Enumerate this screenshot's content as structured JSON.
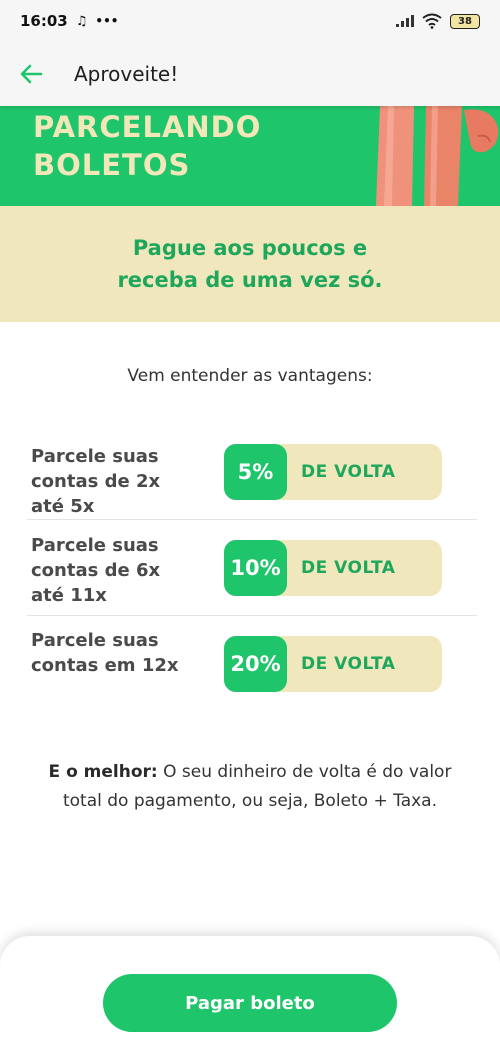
{
  "status_bar": {
    "time": "16:03",
    "more": "•••",
    "battery": "38"
  },
  "app_bar": {
    "title": "Aproveite!"
  },
  "banner": {
    "line1": "PARCELANDO",
    "line2": "BOLETOS"
  },
  "tagline": {
    "line1": "Pague aos poucos e",
    "line2": "receba de uma vez só."
  },
  "intro": "Vem entender as vantagens:",
  "benefits": [
    {
      "line1": "Parcele suas",
      "line2": "contas de 2x",
      "line3": "até 5x",
      "percent": "5%",
      "label": "DE VOLTA"
    },
    {
      "line1": "Parcele suas",
      "line2": "contas de 6x",
      "line3": "até 11x",
      "percent": "10%",
      "label": "DE VOLTA"
    },
    {
      "line1": "Parcele suas",
      "line2": "contas em 12x",
      "line3": "",
      "percent": "20%",
      "label": "DE VOLTA"
    }
  ],
  "note": {
    "bold": "E o melhor:",
    "line1": " O seu dinheiro de volta é do valor",
    "line2": "total do pagamento, ou seja, Boleto + Taxa."
  },
  "cta": {
    "label": "Pagar boleto"
  },
  "colors": {
    "brand_green": "#1ec56b",
    "cream": "#f1e7bd",
    "text_green": "#1ea75c"
  }
}
